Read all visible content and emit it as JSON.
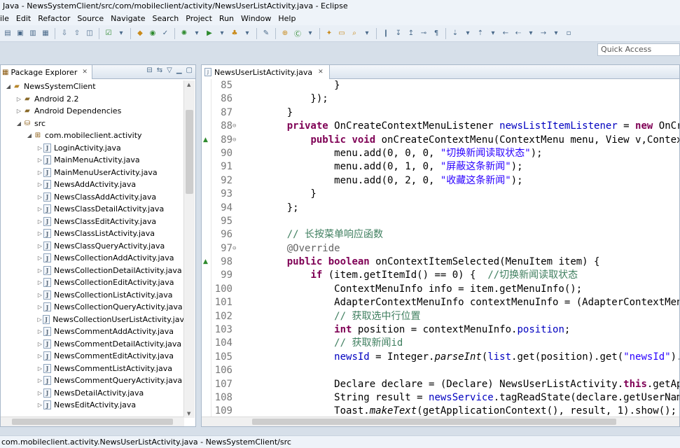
{
  "window": {
    "title": "Java - NewsSystemClient/src/com/mobileclient/activity/NewsUserListActivity.java - Eclipse"
  },
  "menu": [
    "ile",
    "Edit",
    "Refactor",
    "Source",
    "Navigate",
    "Search",
    "Project",
    "Run",
    "Window",
    "Help"
  ],
  "quick_access": {
    "placeholder": "Quick Access"
  },
  "explorer": {
    "tab_label": "Package Explorer",
    "rows": [
      {
        "label": "NewsSystemClient",
        "depth": 0,
        "icon": "project-icon",
        "arrow": "expanded"
      },
      {
        "label": "Android 2.2",
        "depth": 1,
        "icon": "library-icon",
        "arrow": "collapsed"
      },
      {
        "label": "Android Dependencies",
        "depth": 1,
        "icon": "library-icon",
        "arrow": "collapsed"
      },
      {
        "label": "src",
        "depth": 1,
        "icon": "source-folder-icon",
        "arrow": "expanded"
      },
      {
        "label": "com.mobileclient.activity",
        "depth": 2,
        "icon": "package-icon",
        "arrow": "expanded"
      },
      {
        "label": "LoginActivity.java",
        "depth": 3,
        "icon": "java-file-icon",
        "arrow": "collapsed"
      },
      {
        "label": "MainMenuActivity.java",
        "depth": 3,
        "icon": "java-file-icon",
        "arrow": "collapsed"
      },
      {
        "label": "MainMenuUserActivity.java",
        "depth": 3,
        "icon": "java-file-icon",
        "arrow": "collapsed"
      },
      {
        "label": "NewsAddActivity.java",
        "depth": 3,
        "icon": "java-file-icon",
        "arrow": "collapsed"
      },
      {
        "label": "NewsClassAddActivity.java",
        "depth": 3,
        "icon": "java-file-icon",
        "arrow": "collapsed"
      },
      {
        "label": "NewsClassDetailActivity.java",
        "depth": 3,
        "icon": "java-file-icon",
        "arrow": "collapsed"
      },
      {
        "label": "NewsClassEditActivity.java",
        "depth": 3,
        "icon": "java-file-icon",
        "arrow": "collapsed"
      },
      {
        "label": "NewsClassListActivity.java",
        "depth": 3,
        "icon": "java-file-icon",
        "arrow": "collapsed"
      },
      {
        "label": "NewsClassQueryActivity.java",
        "depth": 3,
        "icon": "java-file-icon",
        "arrow": "collapsed"
      },
      {
        "label": "NewsCollectionAddActivity.java",
        "depth": 3,
        "icon": "java-file-icon",
        "arrow": "collapsed"
      },
      {
        "label": "NewsCollectionDetailActivity.java",
        "depth": 3,
        "icon": "java-file-icon",
        "arrow": "collapsed"
      },
      {
        "label": "NewsCollectionEditActivity.java",
        "depth": 3,
        "icon": "java-file-icon",
        "arrow": "collapsed"
      },
      {
        "label": "NewsCollectionListActivity.java",
        "depth": 3,
        "icon": "java-file-icon",
        "arrow": "collapsed"
      },
      {
        "label": "NewsCollectionQueryActivity.java",
        "depth": 3,
        "icon": "java-file-icon",
        "arrow": "collapsed"
      },
      {
        "label": "NewsCollectionUserListActivity.jav",
        "depth": 3,
        "icon": "java-file-icon",
        "arrow": "collapsed"
      },
      {
        "label": "NewsCommentAddActivity.java",
        "depth": 3,
        "icon": "java-file-icon",
        "arrow": "collapsed"
      },
      {
        "label": "NewsCommentDetailActivity.java",
        "depth": 3,
        "icon": "java-file-icon",
        "arrow": "collapsed"
      },
      {
        "label": "NewsCommentEditActivity.java",
        "depth": 3,
        "icon": "java-file-icon",
        "arrow": "collapsed"
      },
      {
        "label": "NewsCommentListActivity.java",
        "depth": 3,
        "icon": "java-file-icon",
        "arrow": "collapsed"
      },
      {
        "label": "NewsCommentQueryActivity.java",
        "depth": 3,
        "icon": "java-file-icon",
        "arrow": "collapsed"
      },
      {
        "label": "NewsDetailActivity.java",
        "depth": 3,
        "icon": "java-file-icon",
        "arrow": "collapsed"
      },
      {
        "label": "NewsEditActivity.java",
        "depth": 3,
        "icon": "java-file-icon",
        "arrow": "collapsed"
      }
    ]
  },
  "editor": {
    "tab_label": "NewsUserListActivity.java",
    "lines": [
      {
        "num": "85",
        "fold": "",
        "marker": "",
        "html": "            }"
      },
      {
        "num": "86",
        "fold": "",
        "marker": "",
        "html": "        });"
      },
      {
        "num": "87",
        "fold": "",
        "marker": "",
        "html": "    }"
      },
      {
        "num": "88",
        "fold": "⊖",
        "marker": "",
        "html": "    <span class=\"kw\">private</span> OnCreateContextMenuListener <span class=\"fld\">newsListItemListener</span> = <span class=\"kw\">new</span> OnCreateContextMenuListener() {"
      },
      {
        "num": "89",
        "fold": "⊖",
        "marker": "▲",
        "html": "        <span class=\"kw\">public</span> <span class=\"kw\">void</span> onCreateContextMenu(ContextMenu menu, View v,ContextMenuInfo menuInfo) {"
      },
      {
        "num": "90",
        "fold": "",
        "marker": "",
        "html": "            menu.add(0, 0, 0, <span class=\"str\">\"切换新闻读取状态\"</span>);"
      },
      {
        "num": "91",
        "fold": "",
        "marker": "",
        "html": "            menu.add(0, 1, 0, <span class=\"str\">\"屏蔽这条新闻\"</span>);"
      },
      {
        "num": "92",
        "fold": "",
        "marker": "",
        "html": "            menu.add(0, 2, 0, <span class=\"str\">\"收藏这条新闻\"</span>);"
      },
      {
        "num": "93",
        "fold": "",
        "marker": "",
        "html": "        }"
      },
      {
        "num": "94",
        "fold": "",
        "marker": "",
        "html": "    };"
      },
      {
        "num": "95",
        "fold": "",
        "marker": "",
        "html": ""
      },
      {
        "num": "96",
        "fold": "",
        "marker": "",
        "html": "    <span class=\"cm\">// 长按菜单响应函数</span>"
      },
      {
        "num": "97",
        "fold": "⊖",
        "marker": "",
        "html": "    <span class=\"an\">@Override</span>"
      },
      {
        "num": "98",
        "fold": "",
        "marker": "▲",
        "html": "    <span class=\"kw\">public</span> <span class=\"kw\">boolean</span> onContextItemSelected(MenuItem item) {"
      },
      {
        "num": "99",
        "fold": "",
        "marker": "",
        "html": "        <span class=\"kw\">if</span> (item.getItemId() == 0) {  <span class=\"cm\">//切换新闻读取状态</span>"
      },
      {
        "num": "100",
        "fold": "",
        "marker": "",
        "html": "            ContextMenuInfo info = item.getMenuInfo();"
      },
      {
        "num": "101",
        "fold": "",
        "marker": "",
        "html": "            AdapterContextMenuInfo contextMenuInfo = (AdapterContextMenuInfo) info;"
      },
      {
        "num": "102",
        "fold": "",
        "marker": "",
        "html": "            <span class=\"cm\">// 获取选中行位置</span>"
      },
      {
        "num": "103",
        "fold": "",
        "marker": "",
        "html": "            <span class=\"kw\">int</span> position = contextMenuInfo.<span class=\"fld\">position</span>;"
      },
      {
        "num": "104",
        "fold": "",
        "marker": "",
        "html": "            <span class=\"cm\">// 获取新闻id</span>"
      },
      {
        "num": "105",
        "fold": "",
        "marker": "",
        "html": "            <span class=\"fld\">newsId</span> = Integer.<span class=\"it\">parseInt</span>(<span class=\"fld\">list</span>.get(position).get(<span class=\"str\">\"newsId\"</span>).toString());"
      },
      {
        "num": "106",
        "fold": "",
        "marker": "",
        "html": ""
      },
      {
        "num": "107",
        "fold": "",
        "marker": "",
        "html": "            Declare declare = (Declare) NewsUserListActivity.<span class=\"kw\">this</span>.getApplication();"
      },
      {
        "num": "108",
        "fold": "",
        "marker": "",
        "html": "            String result = <span class=\"fld\">newsService</span>.tagReadState(declare.getUserName(),<span class=\"fld\">newsId</span>);"
      },
      {
        "num": "109",
        "fold": "",
        "marker": "",
        "html": "            Toast.<span class=\"it\">makeText</span>(getApplicationContext(), result, 1).show();"
      }
    ]
  },
  "status": {
    "text": "com.mobileclient.activity.NewsUserListActivity.java - NewsSystemClient/src"
  }
}
